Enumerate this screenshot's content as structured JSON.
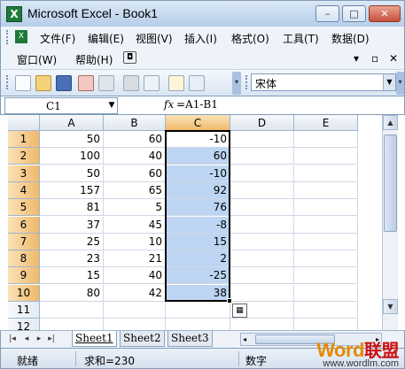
{
  "window": {
    "title": "Microsoft Excel - Book1",
    "app_icon": "excel-icon",
    "min": "–",
    "max": "□",
    "close": "✕"
  },
  "menu": {
    "row1": [
      "文件(F)",
      "编辑(E)",
      "视图(V)",
      "插入(I)",
      "格式(O)",
      "工具(T)",
      "数据(D)"
    ],
    "row2": [
      "窗口(W)",
      "帮助(H)"
    ],
    "row2_right": [
      "▾",
      "▫",
      "✕"
    ]
  },
  "toolbar": {
    "font_name": "宋体"
  },
  "formula_bar": {
    "name_box": "C1",
    "fx": "fx",
    "formula": "=A1-B1"
  },
  "grid": {
    "columns": [
      "A",
      "B",
      "C",
      "D",
      "E"
    ],
    "selected_column": "C",
    "rows": [
      {
        "n": "1",
        "A": "50",
        "B": "60",
        "C": "-10"
      },
      {
        "n": "2",
        "A": "100",
        "B": "40",
        "C": "60"
      },
      {
        "n": "3",
        "A": "50",
        "B": "60",
        "C": "-10"
      },
      {
        "n": "4",
        "A": "157",
        "B": "65",
        "C": "92"
      },
      {
        "n": "5",
        "A": "81",
        "B": "5",
        "C": "76"
      },
      {
        "n": "6",
        "A": "37",
        "B": "45",
        "C": "-8"
      },
      {
        "n": "7",
        "A": "25",
        "B": "10",
        "C": "15"
      },
      {
        "n": "8",
        "A": "23",
        "B": "21",
        "C": "2"
      },
      {
        "n": "9",
        "A": "15",
        "B": "40",
        "C": "-25"
      },
      {
        "n": "10",
        "A": "80",
        "B": "42",
        "C": "38"
      },
      {
        "n": "11",
        "A": "",
        "B": "",
        "C": ""
      },
      {
        "n": "12",
        "A": "",
        "B": "",
        "C": ""
      }
    ]
  },
  "sheets": [
    "Sheet1",
    "Sheet2",
    "Sheet3"
  ],
  "active_sheet": "Sheet1",
  "status": {
    "mode": "就绪",
    "sum": "求和=230",
    "indicator": "数字"
  },
  "watermark": {
    "word": "Word",
    "cn": "联盟",
    "url": "www.wordlm.com"
  },
  "colors": {
    "selection": "#bdd5f2",
    "header_selected": "#f0b96b",
    "accent": "#7f9db9"
  }
}
